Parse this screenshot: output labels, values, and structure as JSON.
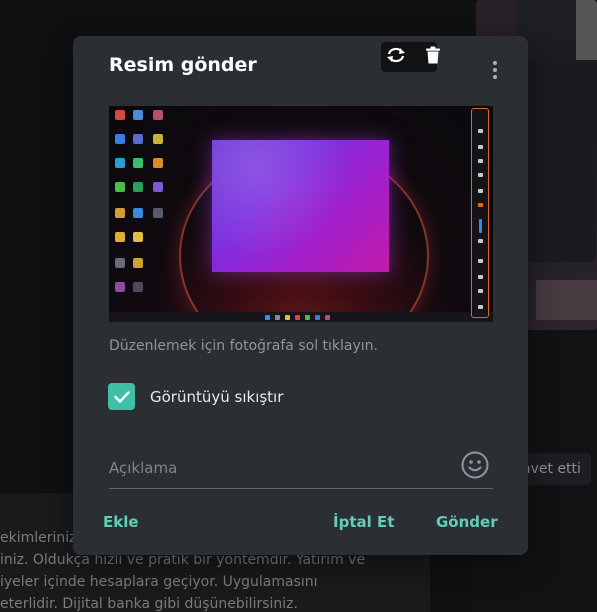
{
  "dialog": {
    "title": "Resim gönder",
    "hint": "Düzenlemek için fotoğrafa sol tıklayın.",
    "compress_label": "Görüntüyü sıkıştır",
    "compress_checked": true,
    "caption_placeholder": "Açıklama",
    "caption_value": "",
    "buttons": {
      "add": "Ekle",
      "cancel": "İptal Et",
      "send": "Gönder"
    },
    "icons": {
      "more": "more-vertical-icon",
      "rotate": "rotate-icon",
      "delete": "trash-icon",
      "emoji": "emoji-icon",
      "check": "checkmark-icon"
    }
  },
  "background": {
    "message_lines": [
      "ekimleriniz",
      "iniz. Oldukça hızlı ve pratik bir yöntemdir. Yatırım ve",
      "iyeler içinde hesaplara geçiyor. Uygulamasını",
      "eterlidir. Dijital banka gibi düşünebilirsiniz."
    ],
    "service_message": "avet etti"
  },
  "colors": {
    "accent": "#5fcfb6",
    "checkbox": "#3fbfa6",
    "modal_bg": "#2b2f34"
  }
}
